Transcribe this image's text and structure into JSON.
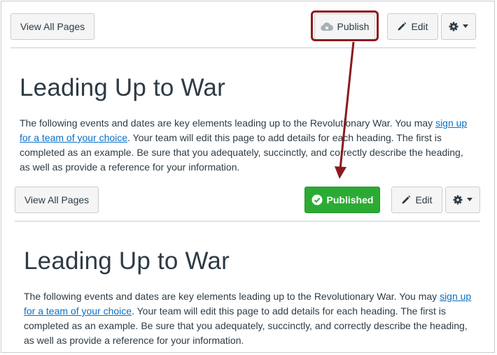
{
  "top": {
    "view_all_pages": "View All Pages",
    "publish": "Publish",
    "edit": "Edit",
    "title": "Leading Up to War",
    "body": {
      "before_link": "The following events and dates are key elements leading up to the Revolutionary War. You may ",
      "link": "sign up for a team of your choice",
      "after_link": ". Your team will edit this page to add details for each heading. The first is completed as an example. Be sure that you adequately, succinctly, and correctly describe the heading, as well as provide a reference for your information."
    }
  },
  "bottom": {
    "view_all_pages": "View All Pages",
    "published": "Published",
    "edit": "Edit",
    "title": "Leading Up to War",
    "body": {
      "before_link": "The following events and dates are key elements leading up to the Revolutionary War. You may ",
      "link": "sign up for a team of your choice",
      "after_link": ". Your team will edit this page to add details for each heading. The first is completed as an example. Be sure that you adequately, succinctly, and correctly describe the heading, as well as provide a reference for your information."
    }
  },
  "icons": {
    "cloud": "cloud-icon",
    "pencil": "pencil-icon",
    "gear": "gear-icon",
    "caret": "caret-down-icon",
    "check": "check-circle-icon"
  },
  "colors": {
    "annotation": "#8b1a1f",
    "published_green": "#2bab33",
    "link_blue": "#0770c7"
  }
}
